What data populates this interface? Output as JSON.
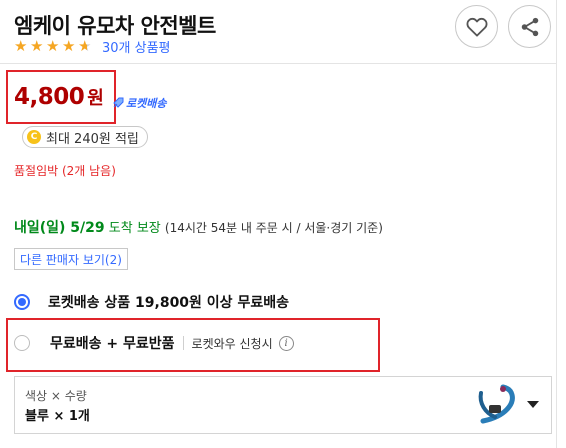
{
  "product": {
    "title": "엠케이 유모차 안전벨트",
    "rating": 4.5,
    "review_link": "30개 상품평"
  },
  "actions": {
    "wishlist_icon": "heart-icon",
    "share_icon": "share-icon"
  },
  "price": {
    "amount": "4,800",
    "unit": "원",
    "badge": "로켓배송",
    "badge_color": "#346aff",
    "price_color": "#ae0000"
  },
  "cashback": {
    "coin": "C",
    "text": "최대 240원 적립"
  },
  "stock": {
    "text": "품절임박 (2개 남음)"
  },
  "delivery": {
    "date": "내일(일) 5/29",
    "guarantee": "도착 보장",
    "note": "(14시간 54분  내 주문 시 / 서울·경기 기준)"
  },
  "other_sellers": {
    "label": "다른 판매자 보기(2)"
  },
  "shipping_options": [
    {
      "label": "로켓배송 상품 19,800원 이상 무료배송",
      "selected": true
    },
    {
      "label": "무료배송 + 무료반품",
      "sub": "로켓와우 신청시",
      "info_icon": "info-icon",
      "selected": false
    }
  ],
  "option_select": {
    "key": "색상 × 수량",
    "value": "블루 × 1개"
  }
}
